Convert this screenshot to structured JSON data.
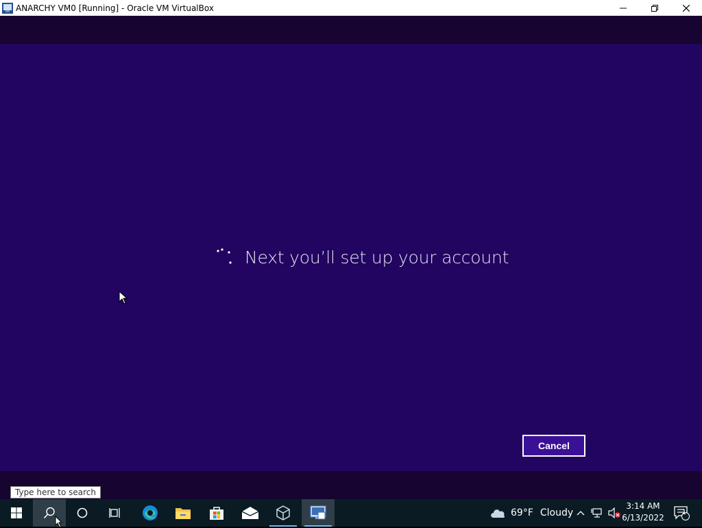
{
  "window": {
    "title": "ANARCHY VM0 [Running] - Oracle VM VirtualBox",
    "minimize_icon": "minimize-icon",
    "restore_icon": "restore-icon",
    "close_icon": "close-icon"
  },
  "oobe": {
    "message": "Next you’ll set up your account",
    "cancel_label": "Cancel",
    "spinner_icon": "loading-dots-icon"
  },
  "search": {
    "tooltip": "Type here to search"
  },
  "taskbar": {
    "apps": [
      {
        "name": "start",
        "icon": "windows-logo-icon"
      },
      {
        "name": "search",
        "icon": "search-icon"
      },
      {
        "name": "cortana",
        "icon": "cortana-circle-icon"
      },
      {
        "name": "task-view",
        "icon": "task-view-icon"
      },
      {
        "name": "edge",
        "icon": "edge-icon"
      },
      {
        "name": "file-explorer",
        "icon": "folder-icon"
      },
      {
        "name": "store",
        "icon": "store-bag-icon"
      },
      {
        "name": "mail",
        "icon": "mail-icon"
      },
      {
        "name": "virtualbox",
        "icon": "virtualbox-cube-icon"
      },
      {
        "name": "vm-window",
        "icon": "vm-window-icon"
      }
    ],
    "weather": {
      "temp": "69°F",
      "condition": "Cloudy",
      "icon": "cloud-icon"
    },
    "clock": {
      "time": "3:14 AM",
      "date": "6/13/2022"
    },
    "notifications_count": "1"
  },
  "colors": {
    "oobe_bg": "#210560",
    "band_bg": "#170431",
    "taskbar_bg": "#0a1b24",
    "accent": "#76b9ed"
  }
}
